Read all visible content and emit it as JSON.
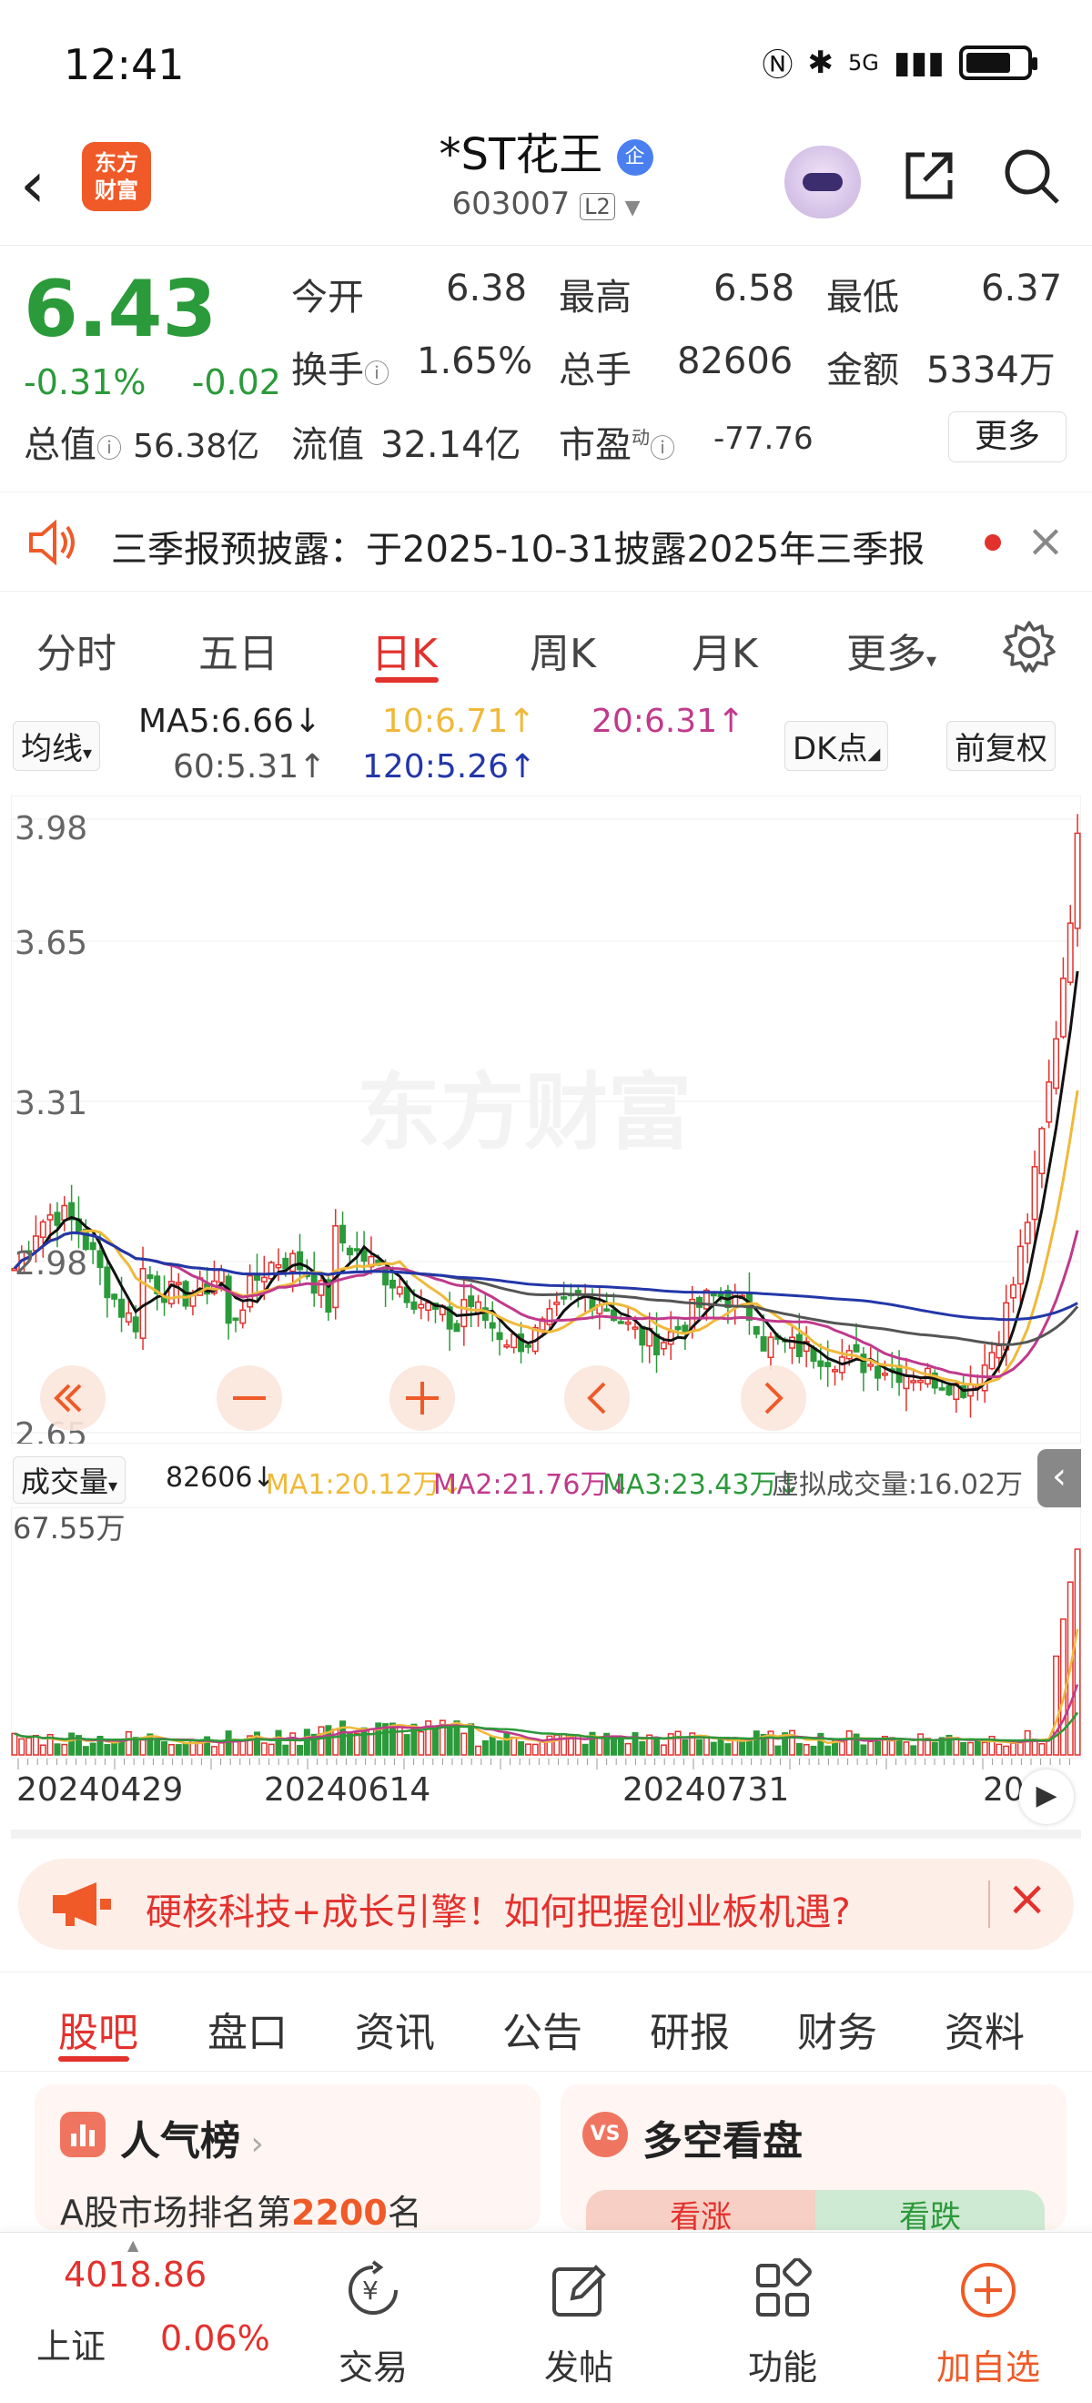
{
  "status": {
    "time": "12:41",
    "network": "5G",
    "battery_level": 0.75
  },
  "header": {
    "app_logo": "东方\n财富",
    "title": "*ST花王",
    "badge": "企",
    "code": "603007",
    "level": "L2"
  },
  "quote": {
    "price": "6.43",
    "change_pct": "-0.31%",
    "change": "-0.02",
    "open_label": "今开",
    "open": "6.38",
    "high_label": "最高",
    "high": "6.58",
    "low_label": "最低",
    "low": "6.37",
    "turnover_label": "换手",
    "turnover": "1.65%",
    "volume_label": "总手",
    "volume": "82606",
    "amount_label": "金额",
    "amount": "5334万",
    "total_cap_label": "总值",
    "total_cap": "56.38亿",
    "float_cap_label": "流值",
    "float_cap": "32.14亿",
    "pe_label": "市盈",
    "pe_sup": "动",
    "pe": "-77.76",
    "more_label": "更多"
  },
  "notice": {
    "text": "三季报预披露：于2025-10-31披露2025年三季报"
  },
  "tabs": {
    "items": [
      "分时",
      "五日",
      "日K",
      "周K",
      "月K",
      "更多"
    ],
    "active": "日K"
  },
  "ma": {
    "selector": "均线",
    "ma5": "MA5:6.66↓",
    "ma10": "10:6.71↑",
    "ma20": "20:6.31↑",
    "ma60": "60:5.31↑",
    "ma120": "120:5.26↑",
    "dk_label": "DK点",
    "adjust_label": "前复权",
    "colors": {
      "ma5": "#111111",
      "ma10": "#f0b93a",
      "ma20": "#c03a8c",
      "ma60": "#555555",
      "ma120": "#2337a8"
    }
  },
  "kchart": {
    "y_labels": [
      "3.98",
      "3.65",
      "3.31",
      "2.98",
      "2.65"
    ],
    "watermark": "东方财富"
  },
  "volume": {
    "selector": "成交量",
    "current": "82606↓",
    "ma1": "MA1:20.12万↓",
    "ma2": "MA2:21.76万↓",
    "ma3": "MA3:23.43万↓",
    "virtual": "虚拟成交量:16.02万",
    "max_label": "67.55万",
    "colors": {
      "ma1": "#f0b93a",
      "ma2": "#c03a8c",
      "ma3": "#2b9a3a"
    }
  },
  "dates": [
    "20240429",
    "20240614",
    "20240731",
    "20"
  ],
  "banner": {
    "text": "硬核科技+成长引擎！如何把握创业板机遇?"
  },
  "section_tabs": {
    "items": [
      "股吧",
      "盘口",
      "资讯",
      "公告",
      "研报",
      "财务",
      "资料"
    ],
    "active": "股吧"
  },
  "cards": {
    "popularity_title": "人气榜",
    "popularity_text_prefix": "A股市场排名第",
    "popularity_rank": "2200",
    "popularity_text_suffix": "名",
    "vs_title": "多空看盘",
    "bull": "看涨",
    "bear": "看跌"
  },
  "bottom_bar": {
    "index_value": "4018.86",
    "index_name": "上证",
    "index_change": "0.06%",
    "trade": "交易",
    "post": "发帖",
    "function": "功能",
    "add": "加自选"
  }
}
